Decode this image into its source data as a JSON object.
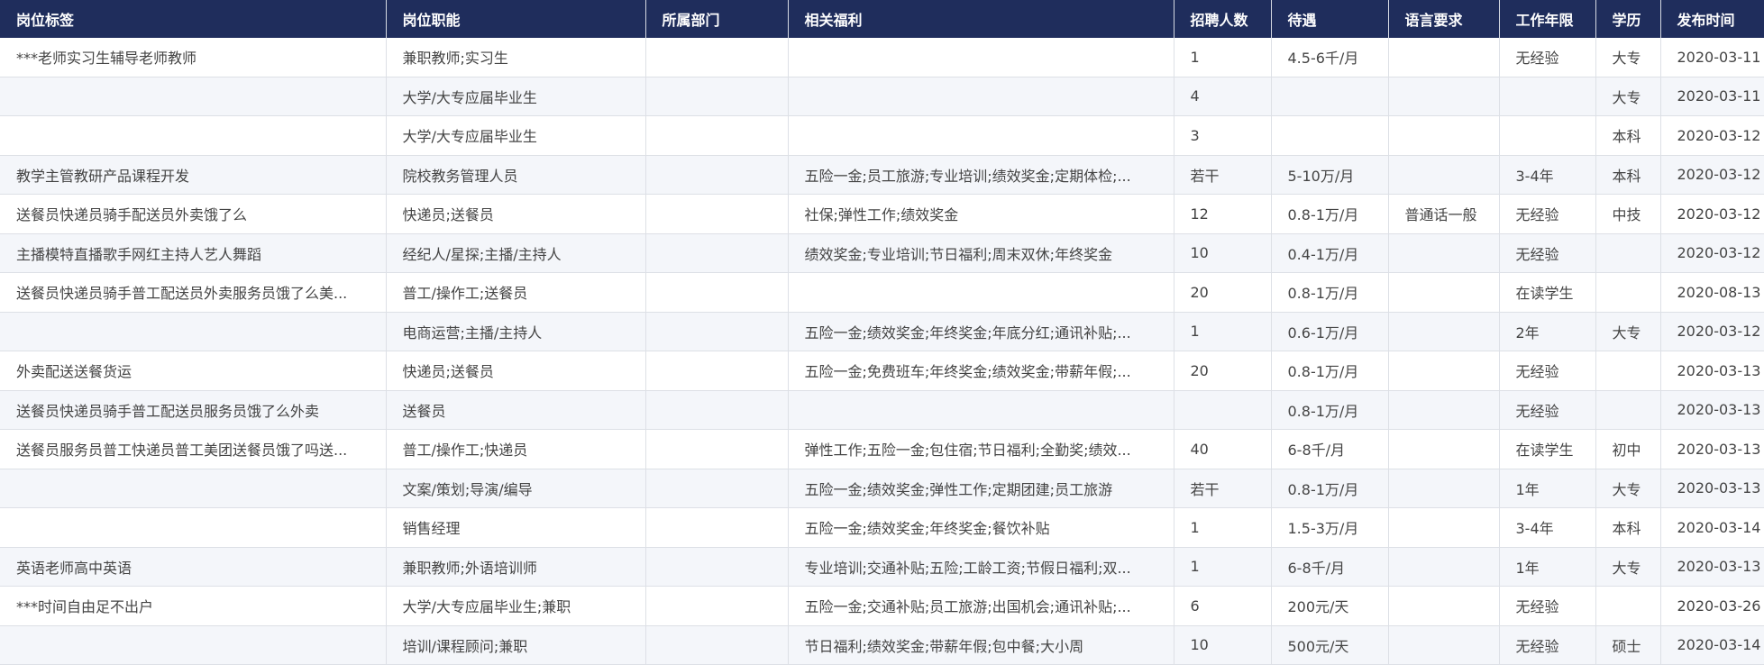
{
  "columns": [
    "岗位标签",
    "岗位职能",
    "所属部门",
    "相关福利",
    "招聘人数",
    "待遇",
    "语言要求",
    "工作年限",
    "学历",
    "发布时间"
  ],
  "rows": [
    [
      "***老师实习生辅导老师教师",
      "兼职教师;实习生",
      "",
      "",
      "1",
      "4.5-6千/月",
      "",
      "无经验",
      "大专",
      "2020-03-11"
    ],
    [
      "",
      "大学/大专应届毕业生",
      "",
      "",
      "4",
      "",
      "",
      "",
      "大专",
      "2020-03-11"
    ],
    [
      "",
      "大学/大专应届毕业生",
      "",
      "",
      "3",
      "",
      "",
      "",
      "本科",
      "2020-03-12"
    ],
    [
      "教学主管教研产品课程开发",
      "院校教务管理人员",
      "",
      "五险一金;员工旅游;专业培训;绩效奖金;定期体检;...",
      "若干",
      "5-10万/月",
      "",
      "3-4年",
      "本科",
      "2020-03-12"
    ],
    [
      "送餐员快递员骑手配送员外卖饿了么",
      "快递员;送餐员",
      "",
      "社保;弹性工作;绩效奖金",
      "12",
      "0.8-1万/月",
      "普通话一般",
      "无经验",
      "中技",
      "2020-03-12"
    ],
    [
      "主播模特直播歌手网红主持人艺人舞蹈",
      "经纪人/星探;主播/主持人",
      "",
      "绩效奖金;专业培训;节日福利;周末双休;年终奖金",
      "10",
      "0.4-1万/月",
      "",
      "无经验",
      "",
      "2020-03-12"
    ],
    [
      "送餐员快递员骑手普工配送员外卖服务员饿了么美...",
      "普工/操作工;送餐员",
      "",
      "",
      "20",
      "0.8-1万/月",
      "",
      "在读学生",
      "",
      "2020-08-13"
    ],
    [
      "",
      "电商运营;主播/主持人",
      "",
      "五险一金;绩效奖金;年终奖金;年底分红;通讯补贴;...",
      "1",
      "0.6-1万/月",
      "",
      "2年",
      "大专",
      "2020-03-12"
    ],
    [
      "外卖配送送餐货运",
      "快递员;送餐员",
      "",
      "五险一金;免费班车;年终奖金;绩效奖金;带薪年假;...",
      "20",
      "0.8-1万/月",
      "",
      "无经验",
      "",
      "2020-03-13"
    ],
    [
      "送餐员快递员骑手普工配送员服务员饿了么外卖",
      "送餐员",
      "",
      "",
      "",
      "0.8-1万/月",
      "",
      "无经验",
      "",
      "2020-03-13"
    ],
    [
      "送餐员服务员普工快递员普工美团送餐员饿了吗送...",
      "普工/操作工;快递员",
      "",
      "弹性工作;五险一金;包住宿;节日福利;全勤奖;绩效...",
      "40",
      "6-8千/月",
      "",
      "在读学生",
      "初中",
      "2020-03-13"
    ],
    [
      "",
      "文案/策划;导演/编导",
      "",
      "五险一金;绩效奖金;弹性工作;定期团建;员工旅游",
      "若干",
      "0.8-1万/月",
      "",
      "1年",
      "大专",
      "2020-03-13"
    ],
    [
      "",
      "销售经理",
      "",
      "五险一金;绩效奖金;年终奖金;餐饮补贴",
      "1",
      "1.5-3万/月",
      "",
      "3-4年",
      "本科",
      "2020-03-14"
    ],
    [
      "英语老师高中英语",
      "兼职教师;外语培训师",
      "",
      "专业培训;交通补贴;五险;工龄工资;节假日福利;双...",
      "1",
      "6-8千/月",
      "",
      "1年",
      "大专",
      "2020-03-13"
    ],
    [
      "***时间自由足不出户",
      "大学/大专应届毕业生;兼职",
      "",
      "五险一金;交通补贴;员工旅游;出国机会;通讯补贴;...",
      "6",
      "200元/天",
      "",
      "无经验",
      "",
      "2020-03-26"
    ],
    [
      "",
      "培训/课程顾问;兼职",
      "",
      "节日福利;绩效奖金;带薪年假;包中餐;大小周",
      "10",
      "500元/天",
      "",
      "无经验",
      "硕士",
      "2020-03-14"
    ]
  ]
}
